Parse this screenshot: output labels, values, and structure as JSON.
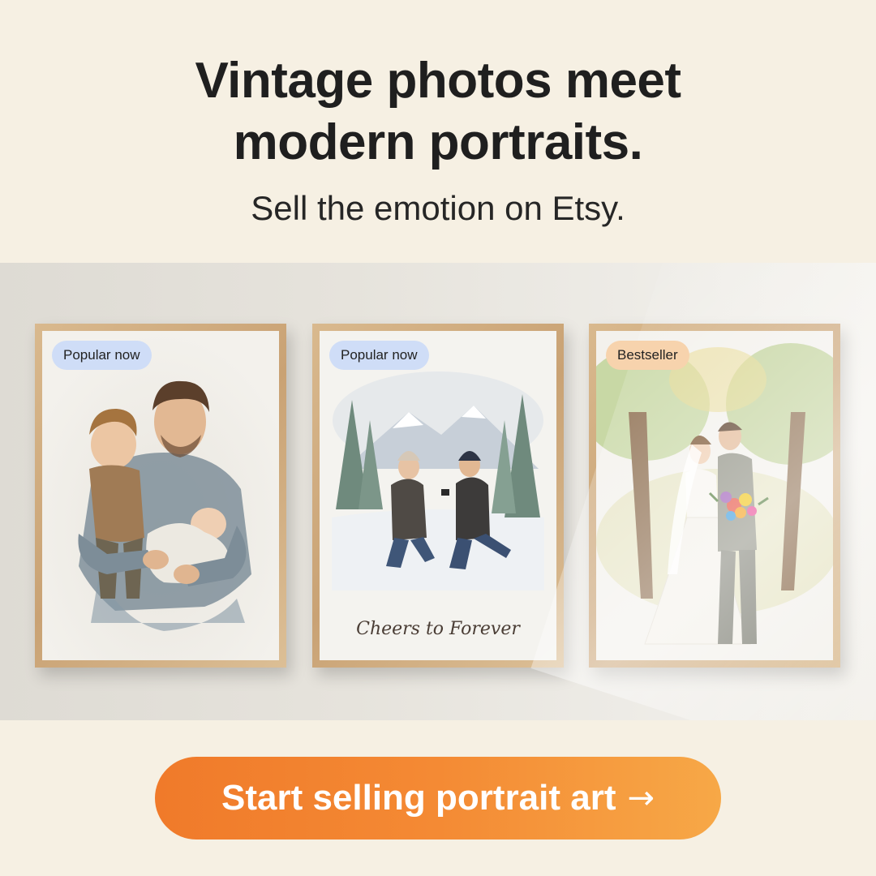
{
  "hero": {
    "headline_line1": "Vintage photos meet",
    "headline_line2": "modern portraits.",
    "subhead": "Sell the emotion on Etsy."
  },
  "frames": [
    {
      "badge": "Popular now",
      "badge_color": "#cfddf7",
      "subject": "father holding toddler and newborn watercolor portrait"
    },
    {
      "badge": "Popular now",
      "badge_color": "#cfddf7",
      "subject": "winter proposal watercolor portrait",
      "caption": "Cheers to Forever"
    },
    {
      "badge": "Bestseller",
      "badge_color": "#f7d3ad",
      "subject": "wedding couple in forest watercolor portrait"
    }
  ],
  "cta": {
    "label": "Start selling portrait art",
    "arrow_icon": "→",
    "colors": [
      "#f07a2a",
      "#f7a847"
    ]
  },
  "colors": {
    "background": "#f6f0e3",
    "headline": "#1f1f1f"
  }
}
